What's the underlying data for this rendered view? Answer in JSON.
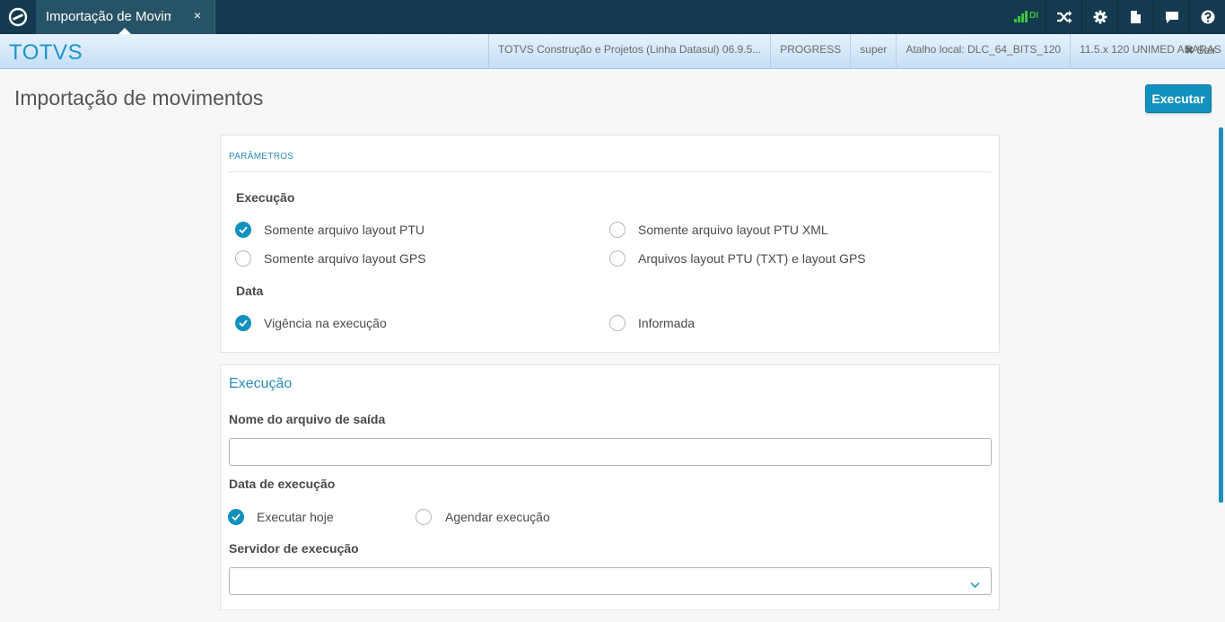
{
  "topbar": {
    "tab_title": "Importação de Movimentos",
    "tab_close": "×",
    "signal_label": "DI",
    "icons": [
      "shuffle-icon",
      "gear-icon",
      "document-icon",
      "chat-icon",
      "help-icon"
    ]
  },
  "brandbar": {
    "brand": "TOTVS",
    "info": [
      "TOTVS Construção e Projetos (Linha Datasul) 06.9.5...",
      "PROGRESS",
      "super",
      "Atalho local: DLC_64_BITS_120",
      "11.5.x 120 UNIMED ARARAS"
    ],
    "logout_label": "Sair"
  },
  "page": {
    "title": "Importação de movimentos",
    "run_button": "Executar"
  },
  "parameters": {
    "caption": "PARÂMETROS",
    "execution_label": "Execução",
    "execution_options": [
      {
        "label": "Somente arquivo layout PTU",
        "checked": true
      },
      {
        "label": "Somente arquivo layout PTU XML",
        "checked": false
      },
      {
        "label": "Somente arquivo layout GPS",
        "checked": false
      },
      {
        "label": "Arquivos layout PTU (TXT) e layout GPS",
        "checked": false
      }
    ],
    "date_label": "Data",
    "date_options": [
      {
        "label": "Vigência na execução",
        "checked": true
      },
      {
        "label": "Informada",
        "checked": false
      }
    ]
  },
  "execution": {
    "heading": "Execução",
    "output_file_label": "Nome do arquivo de saída",
    "output_file_value": "",
    "exec_date_label": "Data de execução",
    "exec_date_options": [
      {
        "label": "Executar hoje",
        "checked": true
      },
      {
        "label": "Agendar execução",
        "checked": false
      }
    ],
    "server_label": "Servidor de execução",
    "server_value": ""
  },
  "colors": {
    "topbar": "#133a4e",
    "accent": "#1191be",
    "brand": "#1e93cc",
    "signal": "#3ec23e"
  }
}
